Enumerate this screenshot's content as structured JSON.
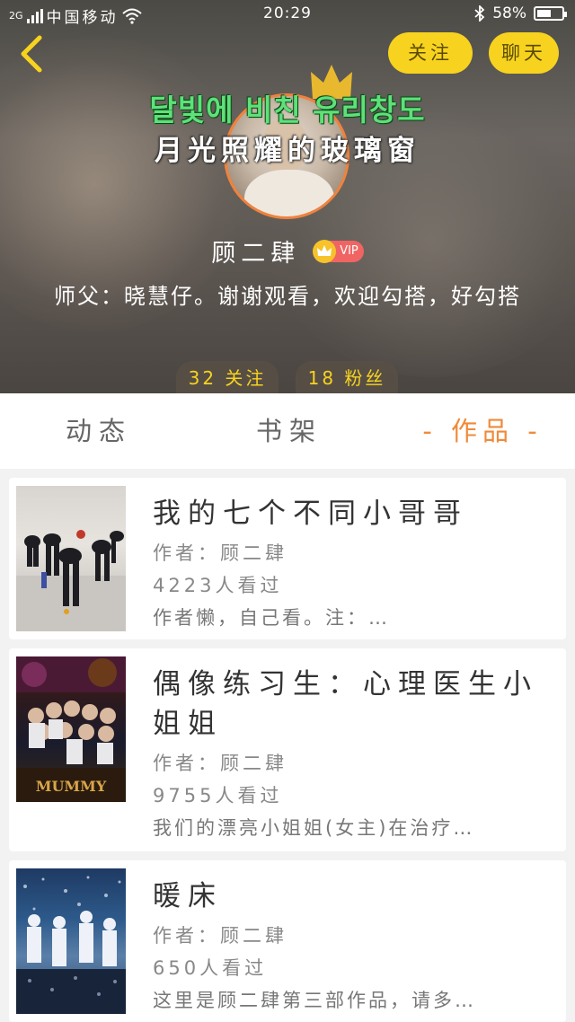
{
  "status_bar": {
    "network": "2G",
    "carrier": "中国移动",
    "time": "20:29",
    "battery": "58%",
    "battery_level": 0.58
  },
  "header": {
    "follow_label": "关注",
    "chat_label": "聊天",
    "title_ko": "달빛에 비친 유리창도",
    "title_zh": "月光照耀的玻璃窗",
    "user_name": "顾二肆",
    "vip_label": "VIP",
    "bio": "师父：晓慧仔。谢谢观看，欢迎勾搭，好勾搭",
    "following_count": "32 关注",
    "fans_count": "18 粉丝",
    "accent_color": "#f7d31f"
  },
  "tabs": [
    {
      "label": "动态",
      "active": false
    },
    {
      "label": "书架",
      "active": false
    },
    {
      "label": "- 作品 -",
      "active": true
    }
  ],
  "works": [
    {
      "title": "我的七个不同小哥哥",
      "author": "作者：顾二肆",
      "views": "4223人看过",
      "summary": "作者懒，自己看。注：…"
    },
    {
      "title": "偶像练习生：心理医生小姐姐",
      "author": "作者：顾二肆",
      "views": "9755人看过",
      "summary": "我们的漂亮小姐姐(女主)在治疗…",
      "thumb_text": "MUMMY"
    },
    {
      "title": "暖床",
      "author": "作者：顾二肆",
      "views": "650人看过",
      "summary": "这里是顾二肆第三部作品，请多…"
    }
  ]
}
